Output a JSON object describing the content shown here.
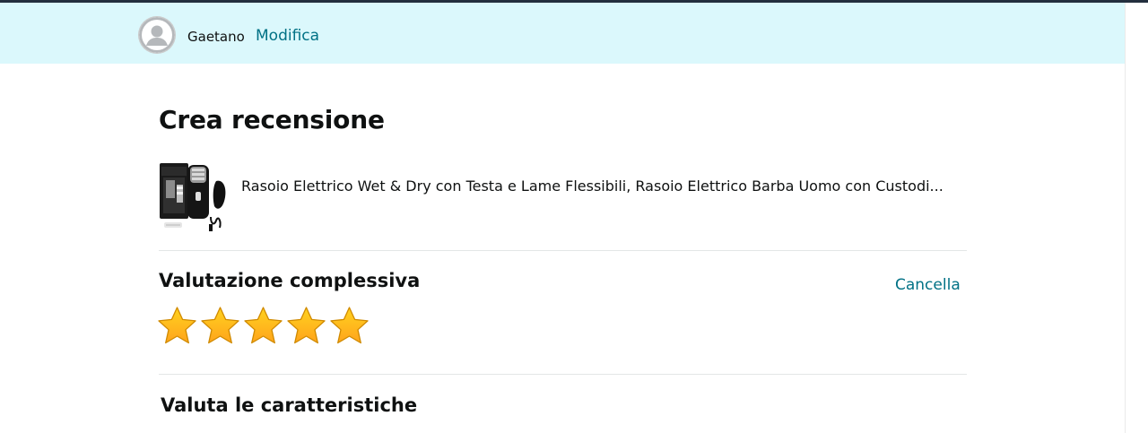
{
  "user": {
    "name": "Gaetano",
    "edit_label": "Modifica"
  },
  "page": {
    "title": "Crea recensione"
  },
  "product": {
    "title": "Rasoio Elettrico Wet & Dry con Testa e Lame Flessibili, Rasoio Elettrico Barba Uomo con Custodi..."
  },
  "overall_rating": {
    "heading": "Valutazione complessiva",
    "clear_label": "Cancella",
    "selected_stars": 5,
    "max_stars": 5,
    "star_color": "#ffa41c"
  },
  "features": {
    "heading": "Valuta le caratteristiche"
  },
  "colors": {
    "user_bar_bg": "#dbf8fc",
    "link": "#007185",
    "text": "#0f1111"
  }
}
